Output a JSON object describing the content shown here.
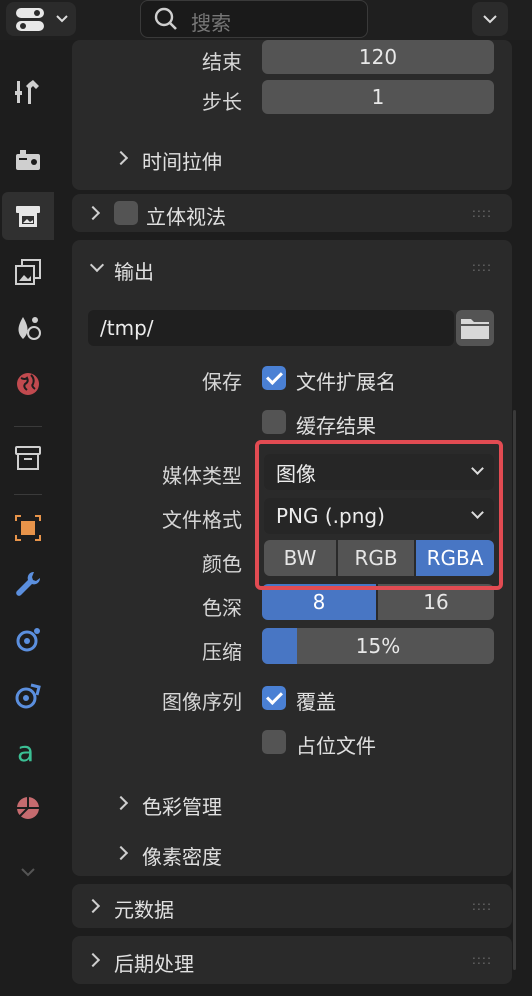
{
  "header": {
    "search_placeholder": "搜索"
  },
  "frame_range": {
    "end_label": "结束",
    "end_value": "120",
    "step_label": "步长",
    "step_value": "1",
    "time_stretch_label": "时间拉伸"
  },
  "stereoscopy": {
    "label": "立体视法"
  },
  "output": {
    "title": "输出",
    "path": "/tmp/",
    "save_label": "保存",
    "file_ext_label": "文件扩展名",
    "cache_label": "缓存结果",
    "media_type_label": "媒体类型",
    "media_type_value": "图像",
    "file_format_label": "文件格式",
    "file_format_value": "PNG (.png)",
    "color_label": "颜色",
    "color_options": [
      "BW",
      "RGB",
      "RGBA"
    ],
    "color_selected": "RGBA",
    "depth_label": "色深",
    "depth_options": [
      "8",
      "16"
    ],
    "depth_selected": "8",
    "compression_label": "压缩",
    "compression_value": "15%",
    "compression_fraction": 0.15,
    "image_sequence_label": "图像序列",
    "overwrite_label": "覆盖",
    "placeholder_label": "占位文件",
    "color_management_label": "色彩管理",
    "pixel_density_label": "像素密度"
  },
  "metadata": {
    "label": "元数据"
  },
  "postprocessing": {
    "label": "后期处理"
  },
  "colors": {
    "accent": "#4a80d4",
    "highlight": "#e24b52"
  },
  "tabs": [
    "tool-icon",
    "render-icon",
    "output-icon",
    "view-layer-icon",
    "scene-icon",
    "world-icon",
    "collection-icon",
    "object-icon",
    "modifier-icon",
    "particles-icon",
    "physics-icon",
    "constraints-icon",
    "data-icon",
    "material-icon"
  ]
}
